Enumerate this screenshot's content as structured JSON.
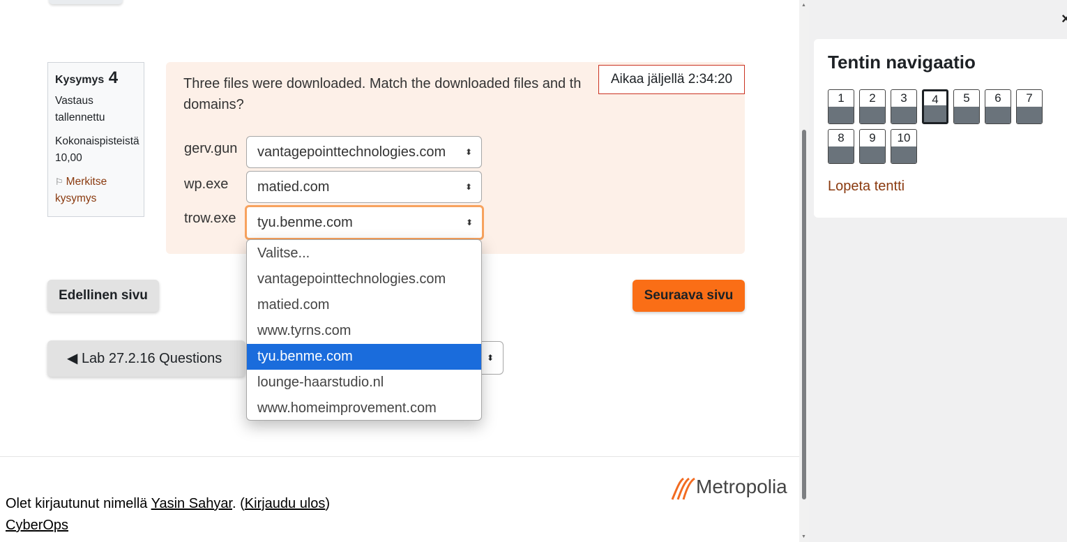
{
  "question": {
    "label": "Kysymys",
    "number": "4",
    "state": "Vastaus tallennettu",
    "grade_label": "Kokonaispisteistä",
    "grade_value": "10,00",
    "flag_label": "Merkitse kysymys",
    "text": "Three files were downloaded. Match the downloaded files and their domains?",
    "text_visible": "Three files were downloaded. Match the downloaded files and th",
    "text_line2": "domains?",
    "rows": [
      {
        "file": "gerv.gun",
        "selected": "vantagepointtechnologies.com"
      },
      {
        "file": "wp.exe",
        "selected": "matied.com"
      },
      {
        "file": "trow.exe",
        "selected": "tyu.benme.com"
      }
    ]
  },
  "timer": {
    "text": "Aikaa jäljellä 2:34:20"
  },
  "dropdown": {
    "options": [
      "Valitse...",
      "vantagepointtechnologies.com",
      "matied.com",
      "www.tyrns.com",
      "tyu.benme.com",
      "lounge-haarstudio.nl",
      "www.homeimprovement.com"
    ],
    "highlighted": "tyu.benme.com"
  },
  "buttons": {
    "prev_page": "Edellinen sivu",
    "next_page": "Seuraava sivu",
    "prev_activity": "◀ Lab 27.2.16 Questions"
  },
  "footer": {
    "logged_in_prefix": "Olet kirjautunut nimellä ",
    "user_name": "Yasin Sahyar",
    "logout_prefix": ". (",
    "logout": "Kirjaudu ulos",
    "logout_suffix": ")",
    "course": "CyberOps",
    "logo_text": "Metropolia"
  },
  "navigation": {
    "title": "Tentin navigaatio",
    "questions": [
      "1",
      "2",
      "3",
      "4",
      "5",
      "6",
      "7",
      "8",
      "9",
      "10"
    ],
    "current": "4",
    "finish": "Lopeta tentti"
  },
  "colors": {
    "accent": "#fa6e16",
    "question_bg": "#fdf0e8",
    "timer_border": "#ca3120",
    "link": "#8a3a0f",
    "selected_option": "#1a6cdc"
  }
}
